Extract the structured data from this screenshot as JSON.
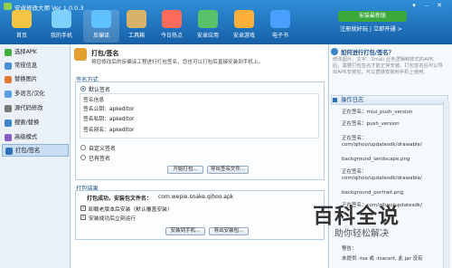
{
  "window": {
    "title": "安卓修改大师 Ver 1.0.0.3"
  },
  "toolbar": {
    "items": [
      {
        "label": "首页",
        "color": "#f6c445"
      },
      {
        "label": "我的手机",
        "color": "#7fd0ff"
      },
      {
        "label": "反编译",
        "color": "#5fc2ff"
      },
      {
        "label": "工具箱",
        "color": "#d9b26a"
      },
      {
        "label": "今日热点",
        "color": "#ff6b5b"
      },
      {
        "label": "安卓应用",
        "color": "#58c26b"
      },
      {
        "label": "安卓游戏",
        "color": "#ffb03b"
      },
      {
        "label": "电子书",
        "color": "#4aa0ff"
      }
    ],
    "promo_label": "安装最新版",
    "register_text": "注册就好玩 | 立即开通 >"
  },
  "sidebar": {
    "items": [
      {
        "label": "选择APK",
        "color": "#3fae3f"
      },
      {
        "label": "常规信息",
        "color": "#4a8fd6"
      },
      {
        "label": "替换图片",
        "color": "#e07a30"
      },
      {
        "label": "多语言/汉化",
        "color": "#5a9de0"
      },
      {
        "label": "源代码修改",
        "color": "#7a7a7a"
      },
      {
        "label": "搜索/替换",
        "color": "#3a86c8"
      },
      {
        "label": "高级模式",
        "color": "#8a5cc8"
      },
      {
        "label": "打包/签名",
        "color": "#2f6fba"
      }
    ],
    "selected_index": 7
  },
  "main": {
    "title": "打包/签名",
    "description": "将您修改后的反编译工程进行打包签名，您也可以打包后直接安装到手机上。",
    "sign_group": {
      "label": "签名方式",
      "default_option": "默认签名",
      "info_title": "签名信息",
      "public_key": "签名公钥：apkeditor",
      "private_key": "签名私钥：apkeditor",
      "alias": "签名别名：apkeditor",
      "custom_option": "自定义签名",
      "existing_option": "已有签名",
      "pack_button": "开始打包...",
      "export_button": "导出签名文件..."
    },
    "result_group": {
      "label": "打包结果",
      "status_text": "打包成功，安装包文件名：",
      "filename": "com.wepie.snake.qihoo.apk",
      "option_uninstall": "卸载老版本后安装（默认覆盖安装）",
      "option_run": "安装成功后立刻运行",
      "install_button": "安装到手机...",
      "export_button": "导出安装包..."
    }
  },
  "right": {
    "help_title": "如何进行打包/签名？",
    "help_text": "修改图片、文字、Smali 业务逻辑和样式的APK后，需要打包签名才能正常安装。打包签名后可以导出APK安装包，可以直接安装到手机上使用。",
    "log_title": "操作日志",
    "log_lines": [
      "正在签名：miui_push_version",
      "正在签名：push_version",
      "正在签名：com/qihoo/updatesdk/drawable/",
      "background_landscape.png",
      "正在签名：com/qihoo/updatesdk/drawable/",
      "background_portrait.png",
      "正在签名：com/qihoo/updatesdk/"
    ],
    "log_tail": [
      "警告：",
      "未提供 -tsa 或 -tsacert, 此 jar 没有"
    ]
  },
  "watermark": {
    "title": "百科全说",
    "subtitle": "助你轻松解决"
  }
}
